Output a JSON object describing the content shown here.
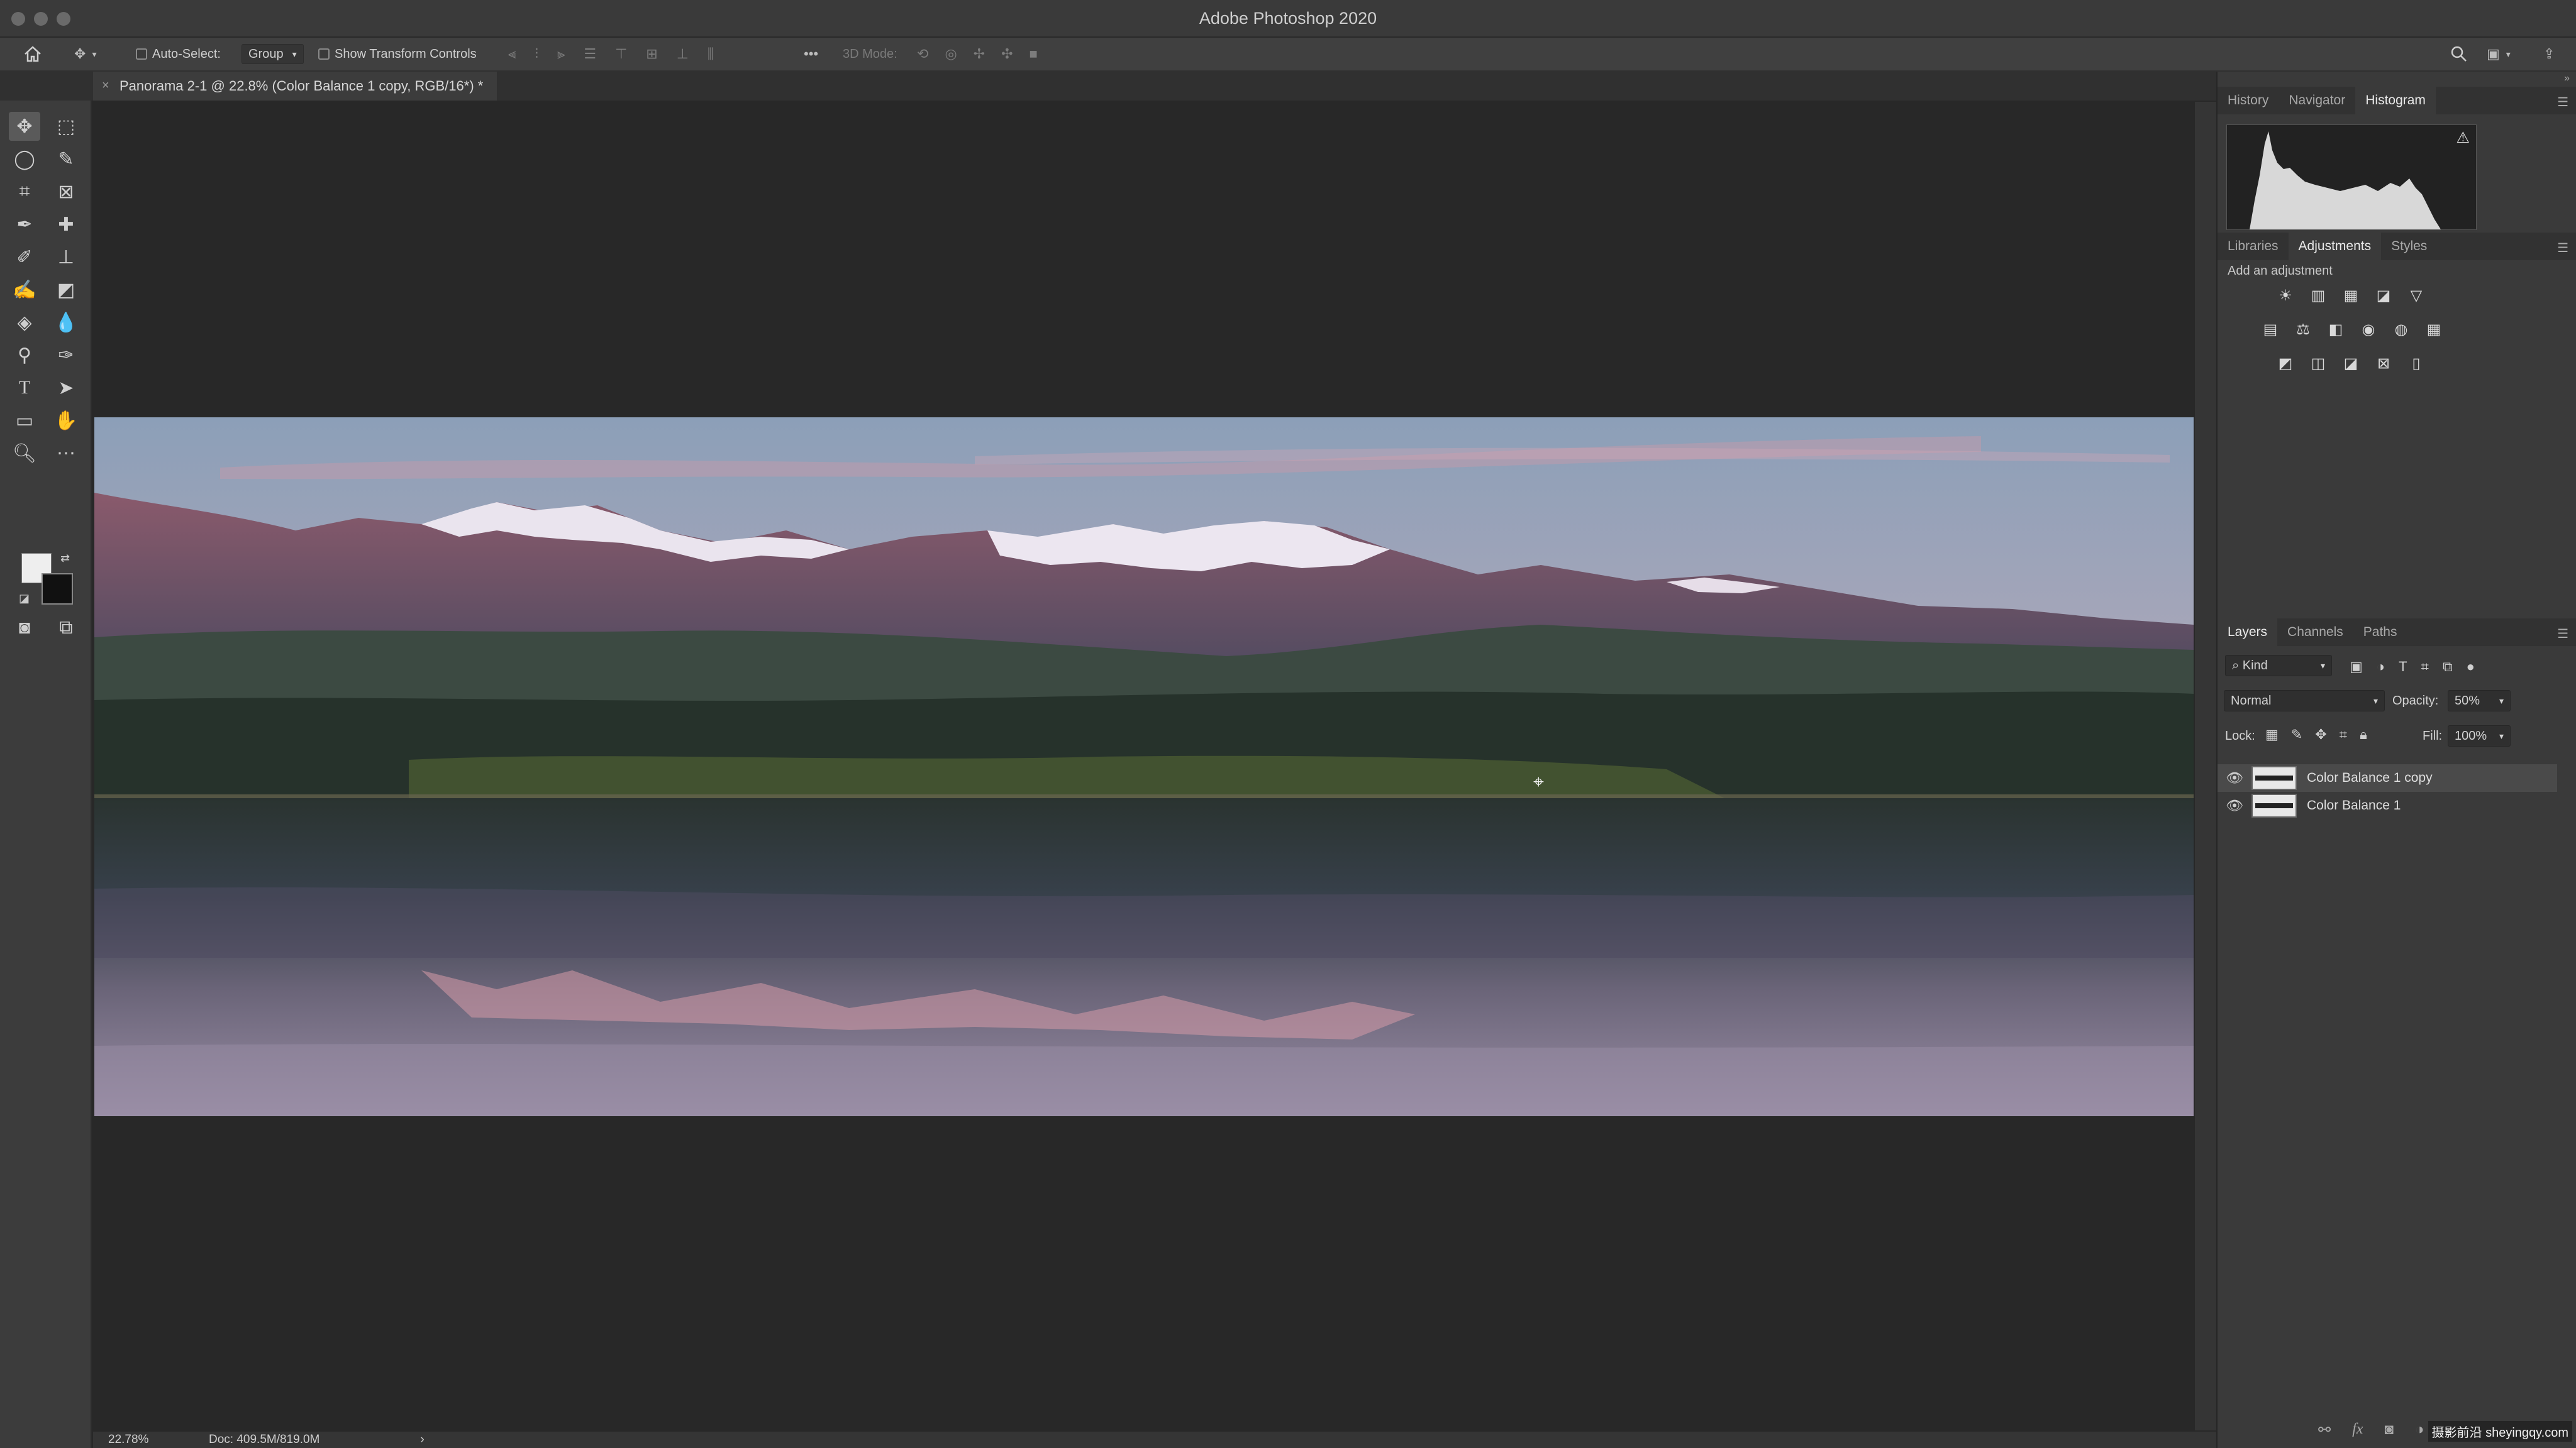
{
  "app": {
    "title": "Adobe Photoshop 2020"
  },
  "options_bar": {
    "auto_select_label": "Auto-Select:",
    "auto_select_mode": "Group",
    "show_transform_label": "Show Transform Controls",
    "mode_3d_label": "3D Mode:"
  },
  "document": {
    "tab_title": "Panorama 2-1 @ 22.8% (Color Balance 1 copy, RGB/16*) *"
  },
  "status": {
    "zoom": "22.78%",
    "doc_size": "Doc: 409.5M/819.0M",
    "arrow": "›"
  },
  "panels": {
    "top_tabs": [
      "History",
      "Navigator",
      "Histogram"
    ],
    "top_active": "Histogram",
    "mid_tabs": [
      "Libraries",
      "Adjustments",
      "Styles"
    ],
    "mid_active": "Adjustments",
    "add_adjustment": "Add an adjustment",
    "layer_tabs": [
      "Layers",
      "Channels",
      "Paths"
    ],
    "layer_active": "Layers"
  },
  "layers": {
    "filter_kind": "Kind",
    "blend_mode": "Normal",
    "opacity_label": "Opacity:",
    "opacity_value": "50%",
    "lock_label": "Lock:",
    "fill_label": "Fill:",
    "fill_value": "100%",
    "items": [
      {
        "name": "Color Balance 1 copy",
        "selected": true
      },
      {
        "name": "Color Balance 1",
        "selected": false
      }
    ]
  },
  "watermark": "摄影前沿 sheyingqy.com"
}
